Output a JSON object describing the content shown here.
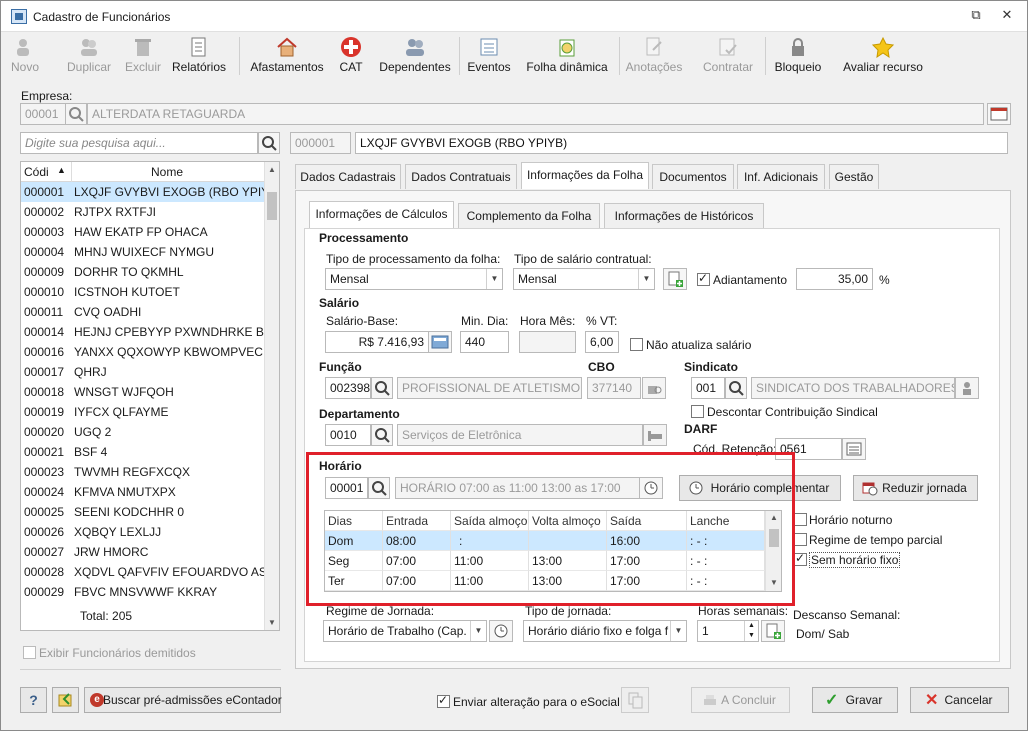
{
  "window": {
    "title": "Cadastro de Funcionários"
  },
  "toolbar": [
    {
      "label": "Novo",
      "icon": "new-user-icon",
      "enabled": false
    },
    {
      "label": "Duplicar",
      "icon": "duplicate-icon",
      "enabled": false
    },
    {
      "label": "Excluir",
      "icon": "trash-icon",
      "enabled": false
    },
    {
      "label": "Relatórios",
      "icon": "report-icon",
      "enabled": true
    },
    {
      "label": "Afastamentos",
      "icon": "house-icon",
      "enabled": true
    },
    {
      "label": "CAT",
      "icon": "red-cross-icon",
      "enabled": true
    },
    {
      "label": "Dependentes",
      "icon": "people-icon",
      "enabled": true
    },
    {
      "label": "Eventos",
      "icon": "list-icon",
      "enabled": true
    },
    {
      "label": "Folha dinâmica",
      "icon": "payroll-icon",
      "enabled": true
    },
    {
      "label": "Anotações",
      "icon": "notes-icon",
      "enabled": false
    },
    {
      "label": "Contratar",
      "icon": "contract-icon",
      "enabled": false
    },
    {
      "label": "Bloqueio",
      "icon": "lock-icon",
      "enabled": true
    },
    {
      "label": "Avaliar recurso",
      "icon": "star-icon",
      "enabled": true
    }
  ],
  "empresa": {
    "label": "Empresa:",
    "code": "00001",
    "name": "ALTERDATA RETAGUARDA"
  },
  "search": {
    "placeholder": "Digite sua pesquisa aqui..."
  },
  "current": {
    "code": "000001",
    "name": "LXQJF GVYBVI EXOGB (RBO YPIYB)"
  },
  "list": {
    "col_code": "Códi",
    "col_name": "Nome",
    "total": "Total: 205",
    "rows": [
      {
        "code": "000001",
        "name": "LXQJF GVYBVI EXOGB (RBO YPIYB)"
      },
      {
        "code": "000002",
        "name": "RJTPX RXTFJI"
      },
      {
        "code": "000003",
        "name": "HAW EKATP FP OHACA"
      },
      {
        "code": "000004",
        "name": "MHNJ WUIXECF NYMGU"
      },
      {
        "code": "000009",
        "name": "DORHR TO QKMHL"
      },
      {
        "code": "000010",
        "name": "ICSTNOH KUTOET"
      },
      {
        "code": "000011",
        "name": "CVQ OADHI"
      },
      {
        "code": "000014",
        "name": "HEJNJ CPEBYYP PXWNDHRKE BTB J"
      },
      {
        "code": "000016",
        "name": "YANXX QQXOWYP KBWOMPVEC A"
      },
      {
        "code": "000017",
        "name": "QHRJ"
      },
      {
        "code": "000018",
        "name": "WNSGT WJFQOH"
      },
      {
        "code": "000019",
        "name": "IYFCX QLFAYME"
      },
      {
        "code": "000020",
        "name": "UGQ 2"
      },
      {
        "code": "000021",
        "name": "BSF 4"
      },
      {
        "code": "000023",
        "name": "TWVMH REGFXCQX"
      },
      {
        "code": "000024",
        "name": "KFMVA NMUTXPX"
      },
      {
        "code": "000025",
        "name": "SEENI KODCHHR 0"
      },
      {
        "code": "000026",
        "name": "XQBQY LEXLJJ"
      },
      {
        "code": "000027",
        "name": "JRW HMORC"
      },
      {
        "code": "000028",
        "name": "XQDVL QAFVFIV EFOUARDVO AST U"
      },
      {
        "code": "000029",
        "name": "FBVC MNSVWWF KKRAY"
      }
    ]
  },
  "exibir_demitidos": "Exibir Funcionários demitidos",
  "tabs": [
    "Dados Cadastrais",
    "Dados Contratuais",
    "Informações da Folha",
    "Documentos",
    "Inf. Adicionais",
    "Gestão"
  ],
  "subtabs": [
    "Informações de Cálculos",
    "Complemento da Folha",
    "Informações de  Históricos"
  ],
  "processamento": {
    "title": "Processamento",
    "tipo_proc_label": "Tipo de processamento da folha:",
    "tipo_proc_value": "Mensal",
    "tipo_sal_label": "Tipo de salário contratual:",
    "tipo_sal_value": "Mensal",
    "adiantamento_label": "Adiantamento",
    "adiantamento_value": "35,00",
    "pct": "%"
  },
  "salario": {
    "title": "Salário",
    "base_label": "Salário-Base:",
    "base_value": "R$ 7.416,93",
    "min_dia_label": "Min. Dia:",
    "min_dia_value": "440",
    "hora_mes_label": "Hora Mês:",
    "vt_label": "% VT:",
    "vt_value": "6,00",
    "nao_atualiza": "Não atualiza salário"
  },
  "funcao": {
    "title": "Função",
    "code": "002398",
    "name": "PROFISSIONAL DE ATLETISMO"
  },
  "cbo": {
    "title": "CBO",
    "value": "377140"
  },
  "sindicato": {
    "title": "Sindicato",
    "code": "001",
    "name": "SINDICATO DOS TRABALHADORES DE",
    "descontar": "Descontar Contribuição Sindical"
  },
  "departamento": {
    "title": "Departamento",
    "code": "0010",
    "name": "Serviços de Eletrônica"
  },
  "darf": {
    "title": "DARF",
    "label": "Cód. Retenção:",
    "value": "0561"
  },
  "horario": {
    "title": "Horário",
    "code": "00001",
    "desc": "HORÁRIO 07:00 as 11:00  13:00 as 17:00",
    "btn_complementar": "Horário complementar",
    "btn_reduzir": "Reduzir jornada",
    "columns": [
      "Dias",
      "Entrada",
      "Saída almoço",
      "Volta almoço",
      "Saída",
      "Lanche"
    ],
    "rows": [
      [
        "Dom",
        "08:00",
        ":",
        "",
        "16:00",
        ":  -  :"
      ],
      [
        "Seg",
        "07:00",
        "11:00",
        "13:00",
        "17:00",
        ":  -  :"
      ],
      [
        "Ter",
        "07:00",
        "11:00",
        "13:00",
        "17:00",
        ":  -  :"
      ]
    ],
    "noturno": "Horário noturno",
    "parcial": "Regime de tempo parcial",
    "sem_fixo": "Sem horário fixo"
  },
  "regime": {
    "label": "Regime de Jornada:",
    "value": "Horário de Trabalho (Cap."
  },
  "tipo_jornada": {
    "label": "Tipo de jornada:",
    "value": "Horário diário fixo e folga f"
  },
  "horas_semanais": {
    "label": "Horas semanais:",
    "value": "1"
  },
  "descanso": {
    "label": "Descanso Semanal:",
    "value": "Dom/ Sab"
  },
  "footer": {
    "buscar": "Buscar pré-admissões eContador",
    "enviar": "Enviar alteração para o eSocial",
    "concluir": "A Concluir",
    "gravar": "Gravar",
    "cancelar": "Cancelar"
  },
  "colors": {
    "highlight": "#e0202a",
    "selection": "#cce8ff",
    "ok": "#2e9e2e",
    "cancel": "#d9342b"
  }
}
